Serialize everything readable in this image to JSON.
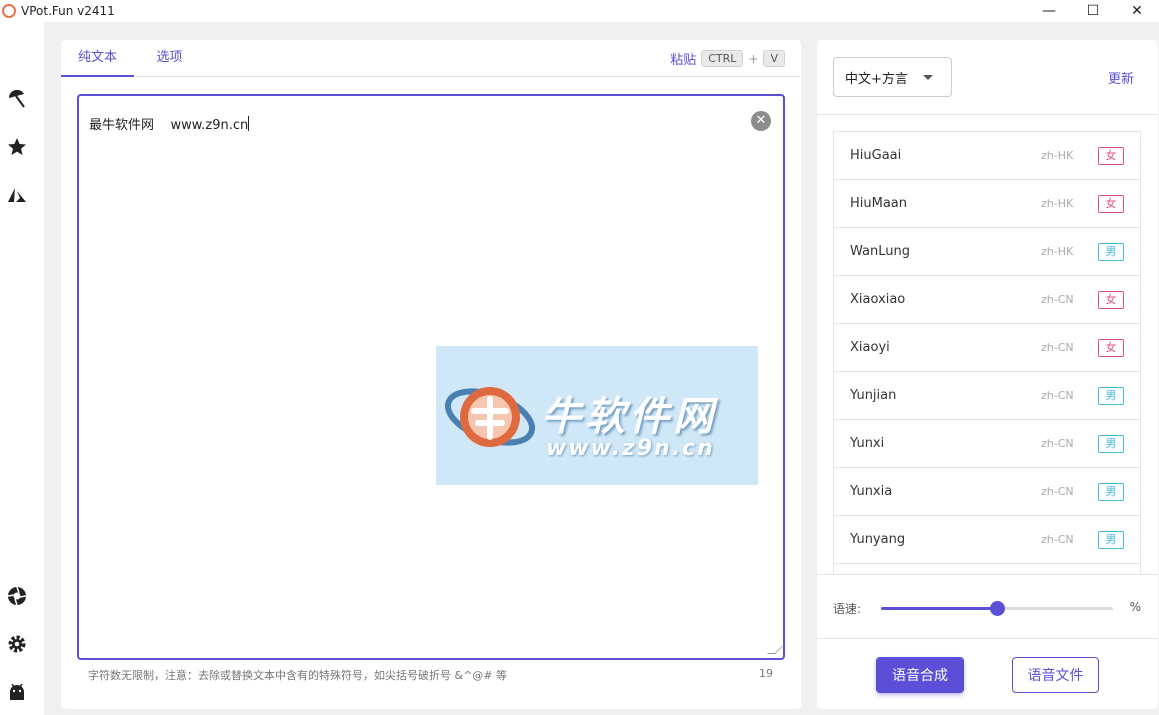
{
  "window": {
    "title": "VPot.Fun v2411",
    "min": "—",
    "max": "☐",
    "close": "✕"
  },
  "sidebar": {
    "icons": [
      "umbrella-icon",
      "star-icon",
      "azure-icon",
      "aperture-icon",
      "gear-icon",
      "android-icon"
    ]
  },
  "left": {
    "tabs": [
      {
        "label": "纯文本",
        "active": true
      },
      {
        "label": "选项",
        "active": false
      }
    ],
    "paste": {
      "label": "粘贴",
      "key1": "CTRL",
      "plus": "+",
      "key2": "V"
    },
    "editor": {
      "text": "最牛软件网    www.z9n.cn"
    },
    "watermark": {
      "title": "牛软件网",
      "url": "www.z9n.cn"
    },
    "hint": "字符数无限制，注意：去除或替换文本中含有的特殊符号，如尖括号破折号 &^@# 等",
    "char_count": "19"
  },
  "right": {
    "language_select": "中文+方言",
    "update_label": "更新",
    "voices": [
      {
        "name": "HiuGaai",
        "locale": "zh-HK",
        "gender": "女",
        "g": "f"
      },
      {
        "name": "HiuMaan",
        "locale": "zh-HK",
        "gender": "女",
        "g": "f"
      },
      {
        "name": "WanLung",
        "locale": "zh-HK",
        "gender": "男",
        "g": "m"
      },
      {
        "name": "Xiaoxiao",
        "locale": "zh-CN",
        "gender": "女",
        "g": "f"
      },
      {
        "name": "Xiaoyi",
        "locale": "zh-CN",
        "gender": "女",
        "g": "f"
      },
      {
        "name": "Yunjian",
        "locale": "zh-CN",
        "gender": "男",
        "g": "m"
      },
      {
        "name": "Yunxi",
        "locale": "zh-CN",
        "gender": "男",
        "g": "m"
      },
      {
        "name": "Yunxia",
        "locale": "zh-CN",
        "gender": "男",
        "g": "m"
      },
      {
        "name": "Yunyang",
        "locale": "zh-CN",
        "gender": "男",
        "g": "m"
      }
    ],
    "speed": {
      "label": "语速:",
      "unit": "%",
      "fraction": 0.5
    },
    "synthesize_label": "语音合成",
    "audio_file_label": "语音文件"
  },
  "colors": {
    "accent": "#5a4fd6",
    "female": "#e0507a",
    "male": "#3ec0d3"
  }
}
